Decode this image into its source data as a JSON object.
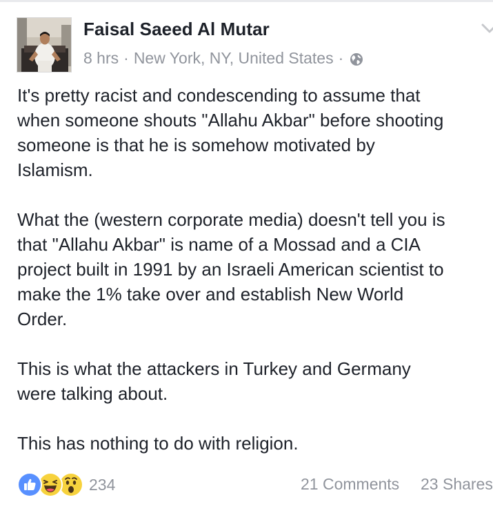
{
  "post": {
    "author": "Faisal Saeed Al Mutar",
    "time": "8 hrs",
    "separator": "·",
    "location": "New York, NY, United States",
    "privacy_icon": "globe-icon",
    "menu_icon": "chevron-down-icon",
    "body": [
      "It's pretty racist and condescending to assume that",
      "when someone shouts \"Allahu Akbar\" before shooting",
      "someone is that he is somehow motivated by",
      "Islamism.",
      "What the (western corporate media) doesn't tell you is",
      "that \"Allahu Akbar\" is name of a Mossad and a CIA",
      "project built in 1991 by an Israeli American scientist to",
      "make the 1% take over and establish New World",
      "Order.",
      "This is what the attackers in Turkey and Germany",
      "were talking about.",
      "This has nothing to do with religion."
    ]
  },
  "footer": {
    "reaction_icons": [
      "like-icon",
      "haha-icon",
      "wow-icon"
    ],
    "reaction_count": "234",
    "comments": "21 Comments",
    "shares": "23 Shares"
  },
  "colors": {
    "text": "#1d2129",
    "meta": "#90949c",
    "like_blue": "#5890ff",
    "emoji_yellow": "#f7d23d"
  }
}
